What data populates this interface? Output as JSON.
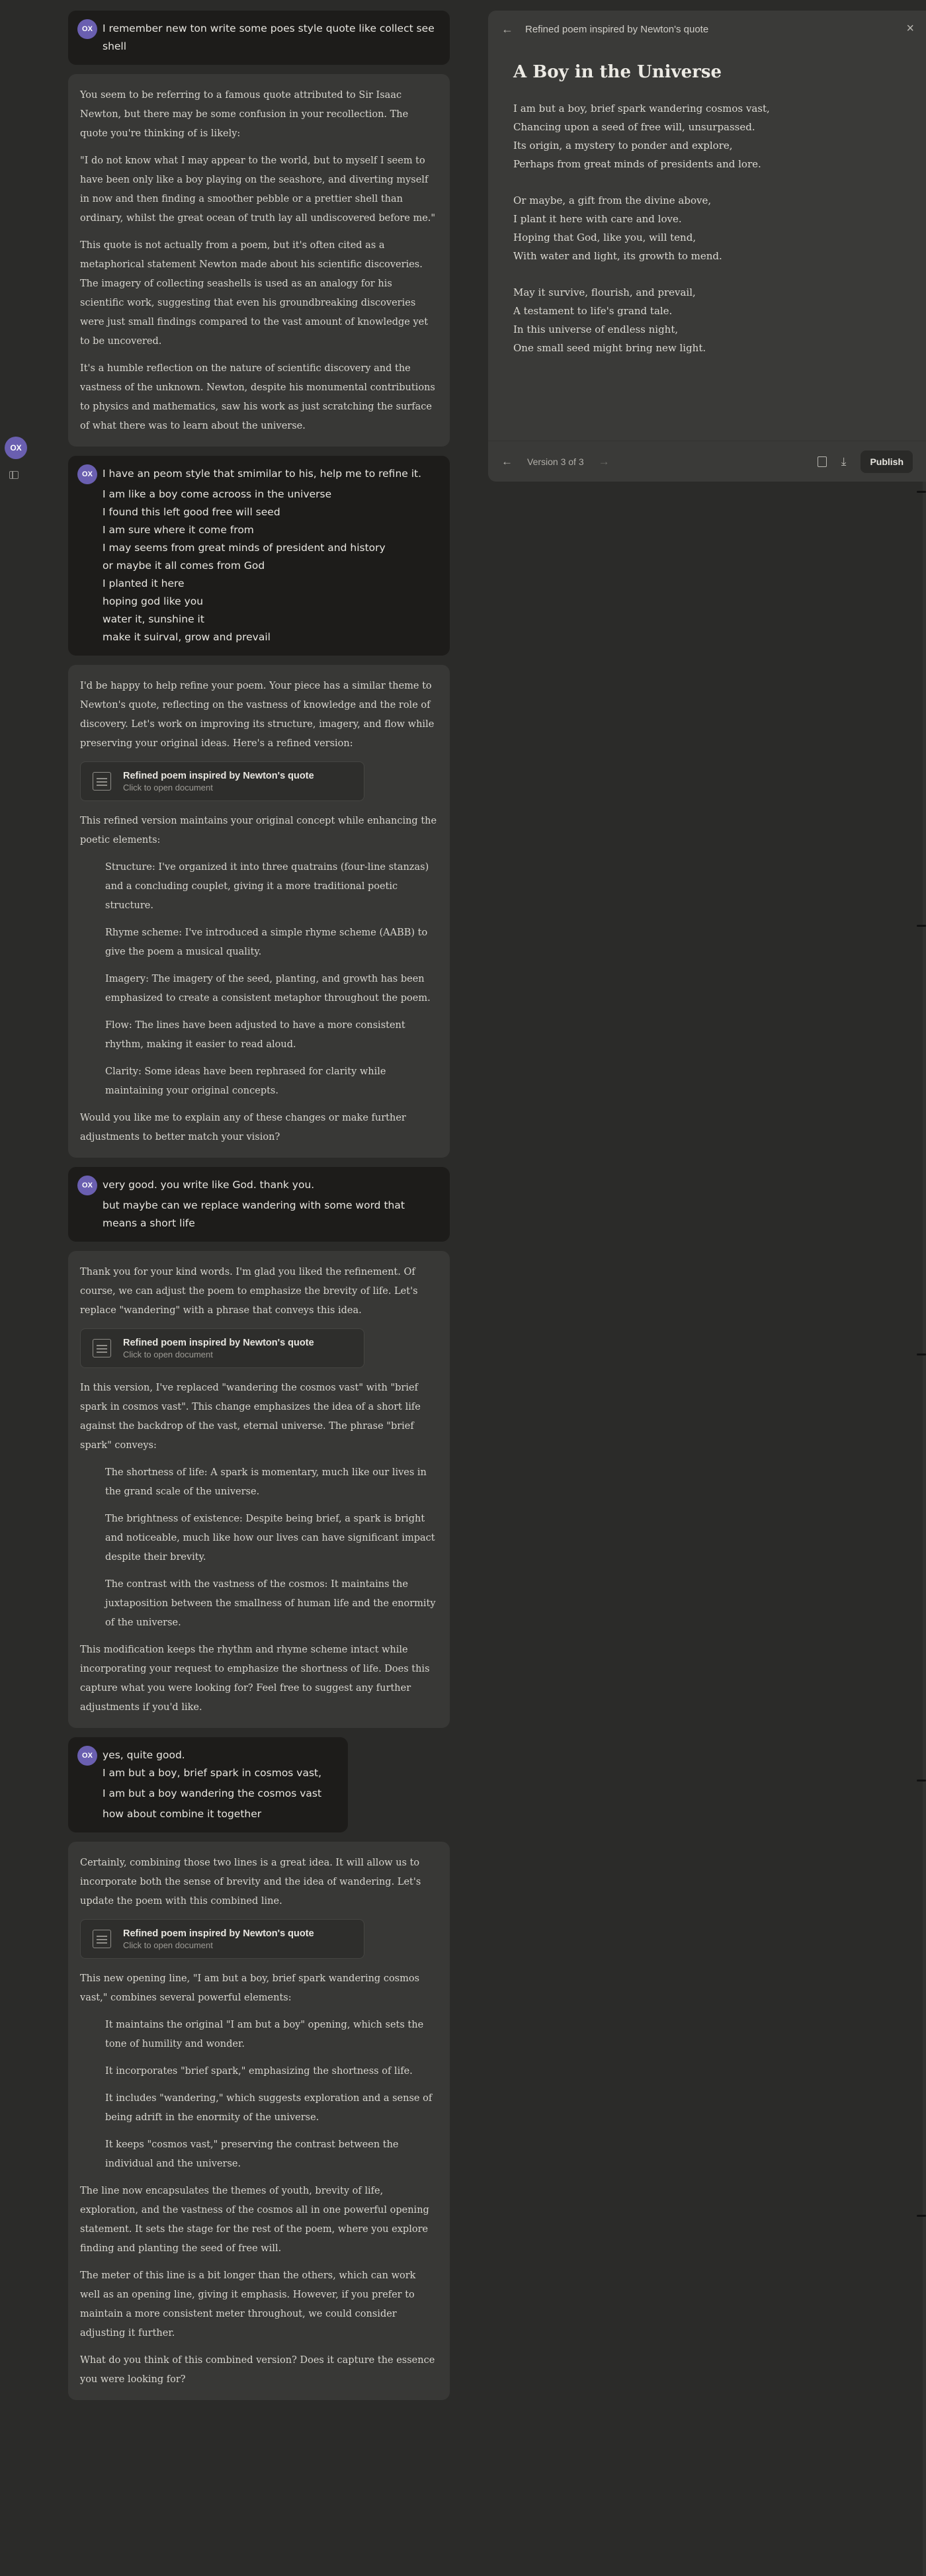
{
  "rail": {
    "avatar_initials": "OX"
  },
  "user_initials": "OX",
  "messages": {
    "u1": {
      "lines": [
        "I remember new ton write some poes style quote like collect see shell"
      ]
    },
    "a1": {
      "paragraphs": [
        "You seem to be referring to a famous quote attributed to Sir Isaac Newton, but there may be some confusion in your recollection. The quote you're thinking of is likely:",
        "\"I do not know what I may appear to the world, but to myself I seem to have been only like a boy playing on the seashore, and diverting myself in now and then finding a smoother pebble or a prettier shell than ordinary, whilst the great ocean of truth lay all undiscovered before me.\"",
        "This quote is not actually from a poem, but it's often cited as a metaphorical statement Newton made about his scientific discoveries. The imagery of collecting seashells is used as an analogy for his scientific work, suggesting that even his groundbreaking discoveries were just small findings compared to the vast amount of knowledge yet to be uncovered.",
        "It's a humble reflection on the nature of scientific discovery and the vastness of the unknown. Newton, despite his monumental contributions to physics and mathematics, saw his work as just scratching the surface of what there was to learn about the universe."
      ]
    },
    "u2": {
      "first": "I have an peom style that smimilar to his, help me to refine it.",
      "poem": [
        "I am like a boy come acrooss in the universe",
        "I found this left good free will seed",
        "I am sure where it come from",
        "I may seems from great minds of president and history",
        "or maybe it all comes from God",
        "I planted it here",
        "hoping god like you",
        "water it, sunshine it",
        "make it suirval, grow and prevail"
      ]
    },
    "a2": {
      "intro": "I'd be happy to help refine your poem. Your piece has a similar theme to Newton's quote, reflecting on the vastness of knowledge and the role of discovery. Let's work on improving its structure, imagery, and flow while preserving your original ideas. Here's a refined version:",
      "after": "This refined version maintains your original concept while enhancing the poetic elements:",
      "bullets": [
        "Structure: I've organized it into three quatrains (four-line stanzas) and a concluding couplet, giving it a more traditional poetic structure.",
        "Rhyme scheme: I've introduced a simple rhyme scheme (AABB) to give the poem a musical quality.",
        "Imagery: The imagery of the seed, planting, and growth has been emphasized to create a consistent metaphor throughout the poem.",
        "Flow: The lines have been adjusted to have a more consistent rhythm, making it easier to read aloud.",
        "Clarity: Some ideas have been rephrased for clarity while maintaining your original concepts."
      ],
      "closing": "Would you like me to explain any of these changes or make further adjustments to better match your vision?"
    },
    "u3": {
      "first": "very good. you write like God. thank you.",
      "rest": [
        "but maybe can we replace wandering with some word that means a short life"
      ]
    },
    "a3": {
      "intro": "Thank you for your kind words. I'm glad you liked the refinement. Of course, we can adjust the poem to emphasize the brevity of life. Let's replace \"wandering\" with a phrase that conveys this idea.",
      "after": "In this version, I've replaced \"wandering the cosmos vast\" with \"brief spark in cosmos vast\". This change emphasizes the idea of a short life against the backdrop of the vast, eternal universe. The phrase \"brief spark\" conveys:",
      "bullets": [
        "The shortness of life: A spark is momentary, much like our lives in the grand scale of the universe.",
        "The brightness of existence: Despite being brief, a spark is bright and noticeable, much like how our lives can have significant impact despite their brevity.",
        "The contrast with the vastness of the cosmos: It maintains the juxtaposition between the smallness of human life and the enormity of the universe."
      ],
      "closing": "This modification keeps the rhythm and rhyme scheme intact while incorporating your request to emphasize the shortness of life. Does this capture what you were looking for? Feel free to suggest any further adjustments if you'd like."
    },
    "u4": {
      "first": "yes, quite good.",
      "rest": [
        "I am but a boy, brief spark in cosmos vast,",
        "I am but a boy wandering the cosmos vast",
        "how about combine it together"
      ]
    },
    "a4": {
      "intro": "Certainly, combining those two lines is a great idea. It will allow us to incorporate both the sense of brevity and the idea of wandering. Let's update the poem with this combined line.",
      "after": "This new opening line, \"I am but a boy, brief spark wandering cosmos vast,\" combines several powerful elements:",
      "bullets": [
        "It maintains the original \"I am but a boy\" opening, which sets the tone of humility and wonder.",
        "It incorporates \"brief spark,\" emphasizing the shortness of life.",
        "It includes \"wandering,\" which suggests exploration and a sense of being adrift in the enormity of the universe.",
        "It keeps \"cosmos vast,\" preserving the contrast between the individual and the universe."
      ],
      "p1": "The line now encapsulates the themes of youth, brevity of life, exploration, and the vastness of the cosmos all in one powerful opening statement. It sets the stage for the rest of the poem, where you explore finding and planting the seed of free will.",
      "p2": "The meter of this line is a bit longer than the others, which can work well as an opening line, giving it emphasis. However, if you prefer to maintain a more consistent meter throughout, we could consider adjusting it further.",
      "closing": "What do you think of this combined version? Does it capture the essence you were looking for?"
    }
  },
  "artifact_card": {
    "title": "Refined poem inspired by Newton's quote",
    "subtitle": "Click to open document"
  },
  "panel": {
    "header_title": "Refined poem inspired by Newton's quote",
    "doc_title": "A Boy in the Universe",
    "stanzas": [
      [
        "I am but a boy, brief spark wandering cosmos vast,",
        "Chancing upon a seed of free will, unsurpassed.",
        "Its origin, a mystery to ponder and explore,",
        "Perhaps from great minds of presidents and lore."
      ],
      [
        "Or maybe, a gift from the divine above,",
        "I plant it here with care and love.",
        "Hoping that God, like you, will tend,",
        "With water and light, its growth to mend."
      ],
      [
        "May it survive, flourish, and prevail,",
        "A testament to life's grand tale.",
        "In this universe of endless night,",
        "One small seed might bring new light."
      ]
    ],
    "version_label": "Version 3 of 3",
    "publish_label": "Publish"
  }
}
